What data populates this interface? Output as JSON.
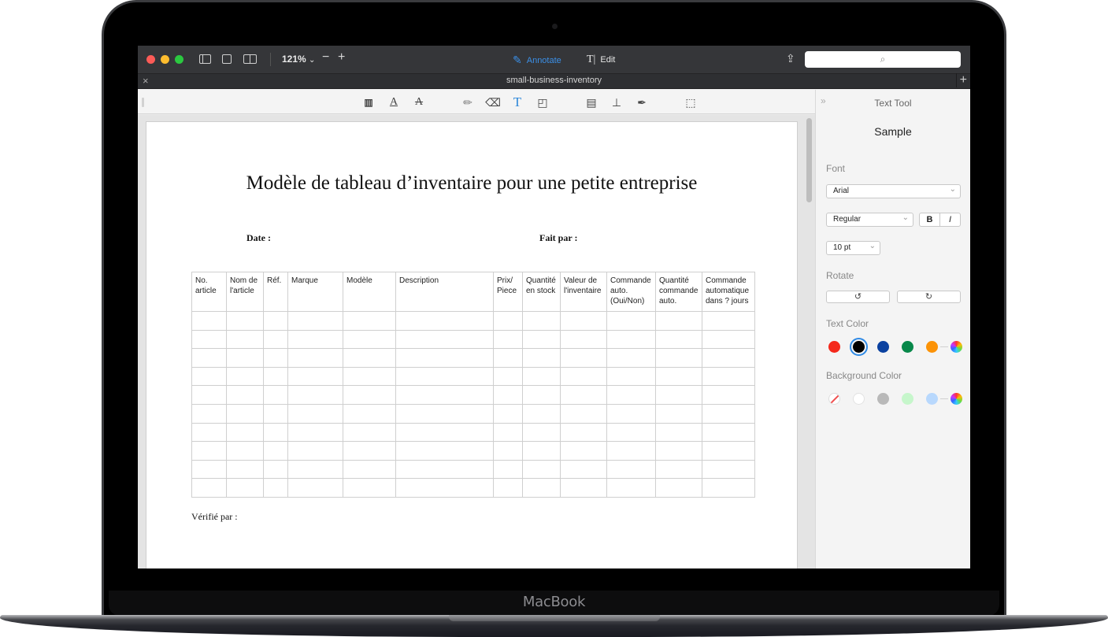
{
  "device": {
    "brand_label": "MacBook"
  },
  "window": {
    "zoom_level": "121%",
    "modes": [
      {
        "label": "Annotate",
        "icon": "pen-icon",
        "active": true
      },
      {
        "label": "Edit",
        "icon": "text-cursor-icon",
        "active": false
      }
    ],
    "search_placeholder": ""
  },
  "tab": {
    "title": "small-business-inventory"
  },
  "annotation_tools": [
    "text-box-icon",
    "underline-text-icon",
    "strikethrough-text-icon",
    "pencil-icon",
    "eraser-icon",
    "text-tool-icon",
    "shapes-icon",
    "note-icon",
    "stamp-icon",
    "signature-pen-icon",
    "selection-icon"
  ],
  "document": {
    "title": "Modèle de tableau d’inventaire pour une petite entreprise",
    "date_label": "Date :",
    "made_by_label": "Fait par :",
    "verified_by_label": "Vérifié par :",
    "table": {
      "headers": [
        "No. article",
        "Nom de l'article",
        "Réf.",
        "Marque",
        "Modèle",
        "Description",
        "Prix/ Piece",
        "Quantité en stock",
        "Valeur de l'inventaire",
        "Commande auto. (Oui/Non)",
        "Quantité commande auto.",
        "Commande automatique dans ? jours"
      ],
      "empty_rows": 10
    }
  },
  "panel": {
    "title": "Text Tool",
    "sample": "Sample",
    "font_label": "Font",
    "font_family": "Arial",
    "font_style": "Regular",
    "bold_label": "B",
    "italic_label": "I",
    "font_size": "10 pt",
    "rotate_label": "Rotate",
    "text_color_label": "Text Color",
    "text_colors": [
      "#f4281b",
      "#000000",
      "#0a41a0",
      "#08884a",
      "#fc9307"
    ],
    "text_color_selected": "#000000",
    "background_color_label": "Background Color",
    "background_colors": [
      "none",
      "#ffffff",
      "#b9b9b9",
      "#c6f6cb",
      "#b8d8fd"
    ],
    "background_color_selected": "none"
  }
}
